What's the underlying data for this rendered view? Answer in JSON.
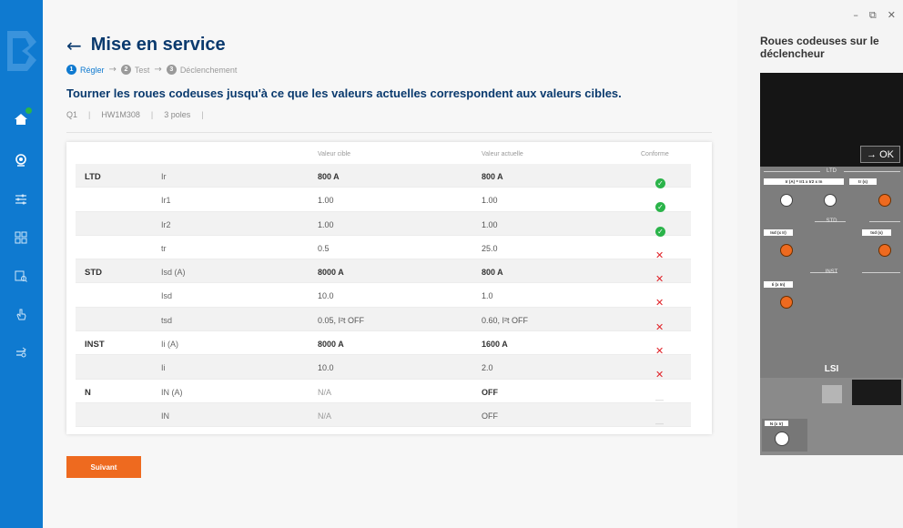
{
  "window": {
    "minimize": "–",
    "maximize": "⧉",
    "close": "✕"
  },
  "header": {
    "title": "Mise en service",
    "back_icon": "arrow-left-icon"
  },
  "stepper": [
    {
      "num": "1",
      "label": "Régler",
      "active": true
    },
    {
      "num": "2",
      "label": "Test",
      "active": false
    },
    {
      "num": "3",
      "label": "Déclenchement",
      "active": false
    }
  ],
  "instruction": "Tourner les roues codeuses jusqu'à ce que les valeurs actuelles correspondent aux valeurs cibles.",
  "meta": {
    "id": "Q1",
    "model": "HW1M308",
    "poles": "3 poles"
  },
  "table": {
    "headers": {
      "target": "Valeur cible",
      "actual": "Valeur actuelle",
      "status": "Conforme"
    },
    "rows": [
      {
        "group": "LTD",
        "param": "Ir",
        "target": "800 A",
        "actual": "800 A",
        "status": "ok",
        "shade": true,
        "bold": true
      },
      {
        "group": "",
        "param": "Ir1",
        "target": "1.00",
        "actual": "1.00",
        "status": "ok",
        "shade": false,
        "bold": false
      },
      {
        "group": "",
        "param": "Ir2",
        "target": "1.00",
        "actual": "1.00",
        "status": "ok",
        "shade": true,
        "bold": false
      },
      {
        "group": "",
        "param": "tr",
        "target": "0.5",
        "actual": "25.0",
        "status": "ko",
        "shade": false,
        "bold": false
      },
      {
        "group": "STD",
        "param": "Isd (A)",
        "target": "8000 A",
        "actual": "800 A",
        "status": "ko",
        "shade": true,
        "bold": true
      },
      {
        "group": "",
        "param": "Isd",
        "target": "10.0",
        "actual": "1.0",
        "status": "ko",
        "shade": false,
        "bold": false
      },
      {
        "group": "",
        "param": "tsd",
        "target": "0.05, I²t OFF",
        "actual": "0.60, I²t OFF",
        "status": "ko",
        "shade": true,
        "bold": false
      },
      {
        "group": "INST",
        "param": "Ii (A)",
        "target": "8000 A",
        "actual": "1600 A",
        "status": "ko",
        "shade": false,
        "bold": true
      },
      {
        "group": "",
        "param": "Ii",
        "target": "10.0",
        "actual": "2.0",
        "status": "ko",
        "shade": true,
        "bold": false
      },
      {
        "group": "N",
        "param": "IN (A)",
        "target": "N/A",
        "actual": "OFF",
        "status": "na",
        "shade": false,
        "bold": true
      },
      {
        "group": "",
        "param": "IN",
        "target": "N/A",
        "actual": "OFF",
        "status": "na",
        "shade": true,
        "bold": false
      }
    ],
    "status_icons": {
      "ok": "✓",
      "ko": "✕",
      "na": "—"
    }
  },
  "next_button": "Suivant",
  "side": {
    "title": "Roues codeuses sur le déclencheur",
    "ok_label": "→ OK",
    "sections": {
      "ltd": "LTD",
      "std": "STD",
      "inst": "INST"
    },
    "dials": {
      "ir": "Ir (A) = Ir1 x Ir2 x In",
      "tr": "tr (s)",
      "isd": "Isd (x Ir)",
      "tsd": "tsd (s)",
      "ii": "Ii (x In)",
      "n": "N (x Ir)"
    },
    "trip_unit_label": "LSI"
  },
  "colors": {
    "brand_blue": "#0f7ad0",
    "title_navy": "#0a3a6e",
    "accent_orange": "#ee6a1f",
    "ok_green": "#2bb44a",
    "ko_red": "#e0242a"
  },
  "rail_icons": [
    "home-icon",
    "location-icon",
    "sliders-icon",
    "grid-icon",
    "report-icon",
    "hand-icon",
    "settings-icon"
  ]
}
